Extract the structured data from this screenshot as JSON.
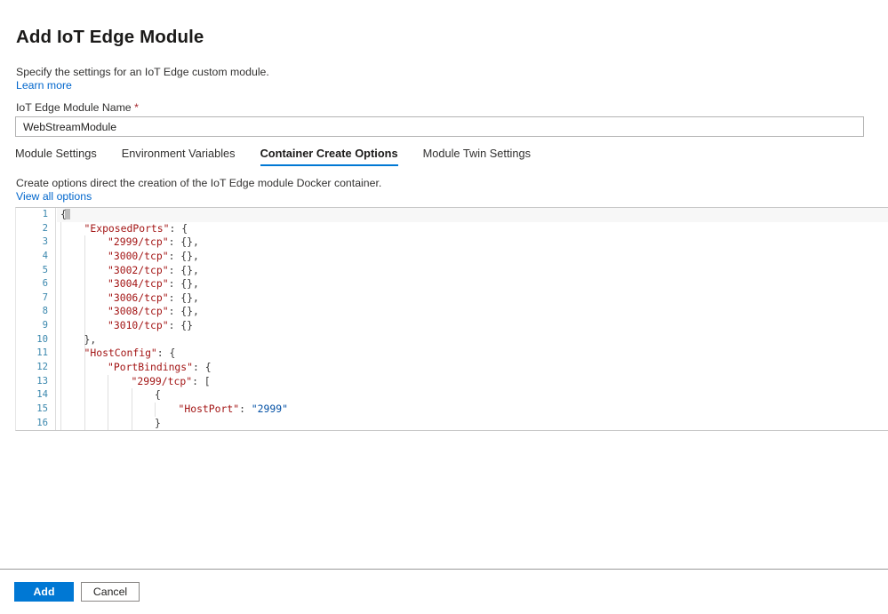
{
  "dialog": {
    "title": "Add IoT Edge Module",
    "description": "Specify the settings for an IoT Edge custom module.",
    "learn_more_label": "Learn more"
  },
  "name_field": {
    "label": "IoT Edge Module Name",
    "required_marker": "*",
    "value": "WebStreamModule",
    "placeholder": ""
  },
  "tabs": [
    {
      "label": "Module Settings",
      "active": false
    },
    {
      "label": "Environment Variables",
      "active": false
    },
    {
      "label": "Container Create Options",
      "active": true
    },
    {
      "label": "Module Twin Settings",
      "active": false
    }
  ],
  "create_options": {
    "description": "Create options direct the creation of the IoT Edge module Docker container.",
    "view_all_label": "View all options"
  },
  "editor": {
    "line_numbers": [
      "1",
      "2",
      "3",
      "4",
      "5",
      "6",
      "7",
      "8",
      "9",
      "10",
      "11",
      "12",
      "13",
      "14",
      "15",
      "16"
    ],
    "lines": [
      {
        "n": "1",
        "indent": 0,
        "tokens": [
          {
            "t": "punct",
            "v": "{"
          }
        ]
      },
      {
        "n": "2",
        "indent": 1,
        "tokens": [
          {
            "t": "key",
            "v": "\"ExposedPorts\""
          },
          {
            "t": "punct",
            "v": ": {"
          }
        ]
      },
      {
        "n": "3",
        "indent": 2,
        "tokens": [
          {
            "t": "key",
            "v": "\"2999/tcp\""
          },
          {
            "t": "punct",
            "v": ": {},"
          }
        ]
      },
      {
        "n": "4",
        "indent": 2,
        "tokens": [
          {
            "t": "key",
            "v": "\"3000/tcp\""
          },
          {
            "t": "punct",
            "v": ": {},"
          }
        ]
      },
      {
        "n": "5",
        "indent": 2,
        "tokens": [
          {
            "t": "key",
            "v": "\"3002/tcp\""
          },
          {
            "t": "punct",
            "v": ": {},"
          }
        ]
      },
      {
        "n": "6",
        "indent": 2,
        "tokens": [
          {
            "t": "key",
            "v": "\"3004/tcp\""
          },
          {
            "t": "punct",
            "v": ": {},"
          }
        ]
      },
      {
        "n": "7",
        "indent": 2,
        "tokens": [
          {
            "t": "key",
            "v": "\"3006/tcp\""
          },
          {
            "t": "punct",
            "v": ": {},"
          }
        ]
      },
      {
        "n": "8",
        "indent": 2,
        "tokens": [
          {
            "t": "key",
            "v": "\"3008/tcp\""
          },
          {
            "t": "punct",
            "v": ": {},"
          }
        ]
      },
      {
        "n": "9",
        "indent": 2,
        "tokens": [
          {
            "t": "key",
            "v": "\"3010/tcp\""
          },
          {
            "t": "punct",
            "v": ": {}"
          }
        ]
      },
      {
        "n": "10",
        "indent": 1,
        "tokens": [
          {
            "t": "punct",
            "v": "},"
          }
        ]
      },
      {
        "n": "11",
        "indent": 1,
        "tokens": [
          {
            "t": "key",
            "v": "\"HostConfig\""
          },
          {
            "t": "punct",
            "v": ": {"
          }
        ]
      },
      {
        "n": "12",
        "indent": 2,
        "tokens": [
          {
            "t": "key",
            "v": "\"PortBindings\""
          },
          {
            "t": "punct",
            "v": ": {"
          }
        ]
      },
      {
        "n": "13",
        "indent": 3,
        "tokens": [
          {
            "t": "key",
            "v": "\"2999/tcp\""
          },
          {
            "t": "punct",
            "v": ": ["
          }
        ]
      },
      {
        "n": "14",
        "indent": 4,
        "tokens": [
          {
            "t": "punct",
            "v": "{"
          }
        ]
      },
      {
        "n": "15",
        "indent": 5,
        "tokens": [
          {
            "t": "key",
            "v": "\"HostPort\""
          },
          {
            "t": "punct",
            "v": ": "
          },
          {
            "t": "str",
            "v": "\"2999\""
          }
        ]
      },
      {
        "n": "16",
        "indent": 4,
        "tokens": [
          {
            "t": "punct",
            "v": "}"
          }
        ]
      }
    ]
  },
  "footer": {
    "add_label": "Add",
    "cancel_label": "Cancel"
  },
  "colors": {
    "accent": "#0078d4",
    "link": "#0066cc",
    "required": "#a4262c",
    "json_key": "#a31515",
    "json_string": "#0451a5",
    "line_number": "#3a87ad"
  }
}
